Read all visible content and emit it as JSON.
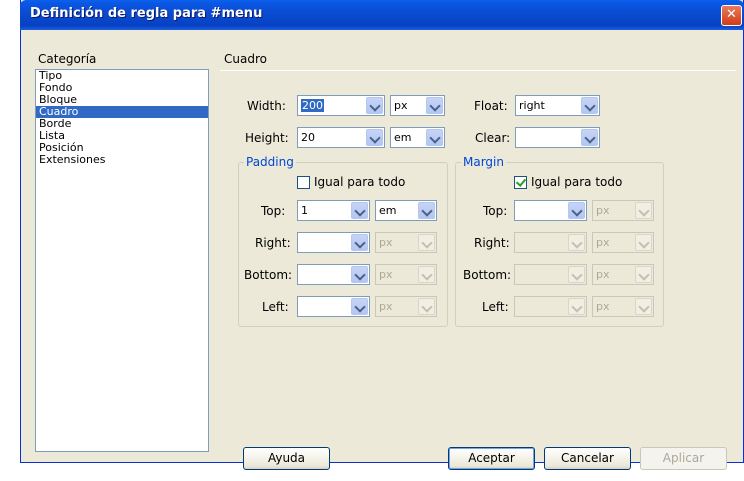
{
  "window": {
    "title": "Definición de regla para #menu",
    "close_glyph": "✕"
  },
  "category": {
    "header": "Categoría",
    "items": [
      "Tipo",
      "Fondo",
      "Bloque",
      "Cuadro",
      "Borde",
      "Lista",
      "Posición",
      "Extensiones"
    ],
    "selected": "Cuadro"
  },
  "section_title": "Cuadro",
  "width": {
    "label": "Width:",
    "value": "200",
    "unit": "px"
  },
  "height": {
    "label": "Height:",
    "value": "20",
    "unit": "em"
  },
  "float": {
    "label": "Float:",
    "value": "right"
  },
  "clear": {
    "label": "Clear:",
    "value": ""
  },
  "padding": {
    "title": "Padding",
    "same_for_all": {
      "label": "Igual para todo",
      "checked": false
    },
    "top": {
      "label": "Top:",
      "value": "1",
      "unit": "em"
    },
    "right": {
      "label": "Right:",
      "value": "",
      "unit": "px"
    },
    "bottom": {
      "label": "Bottom:",
      "value": "",
      "unit": "px"
    },
    "left": {
      "label": "Left:",
      "value": "",
      "unit": "px"
    }
  },
  "margin": {
    "title": "Margin",
    "same_for_all": {
      "label": "Igual para todo",
      "checked": true
    },
    "top": {
      "label": "Top:",
      "value": "",
      "unit": "px"
    },
    "right": {
      "label": "Right:",
      "value": "",
      "unit": "px"
    },
    "bottom": {
      "label": "Bottom:",
      "value": "",
      "unit": "px"
    },
    "left": {
      "label": "Left:",
      "value": "",
      "unit": "px"
    }
  },
  "buttons": {
    "help": "Ayuda",
    "ok": "Aceptar",
    "cancel": "Cancelar",
    "apply": "Aplicar"
  }
}
